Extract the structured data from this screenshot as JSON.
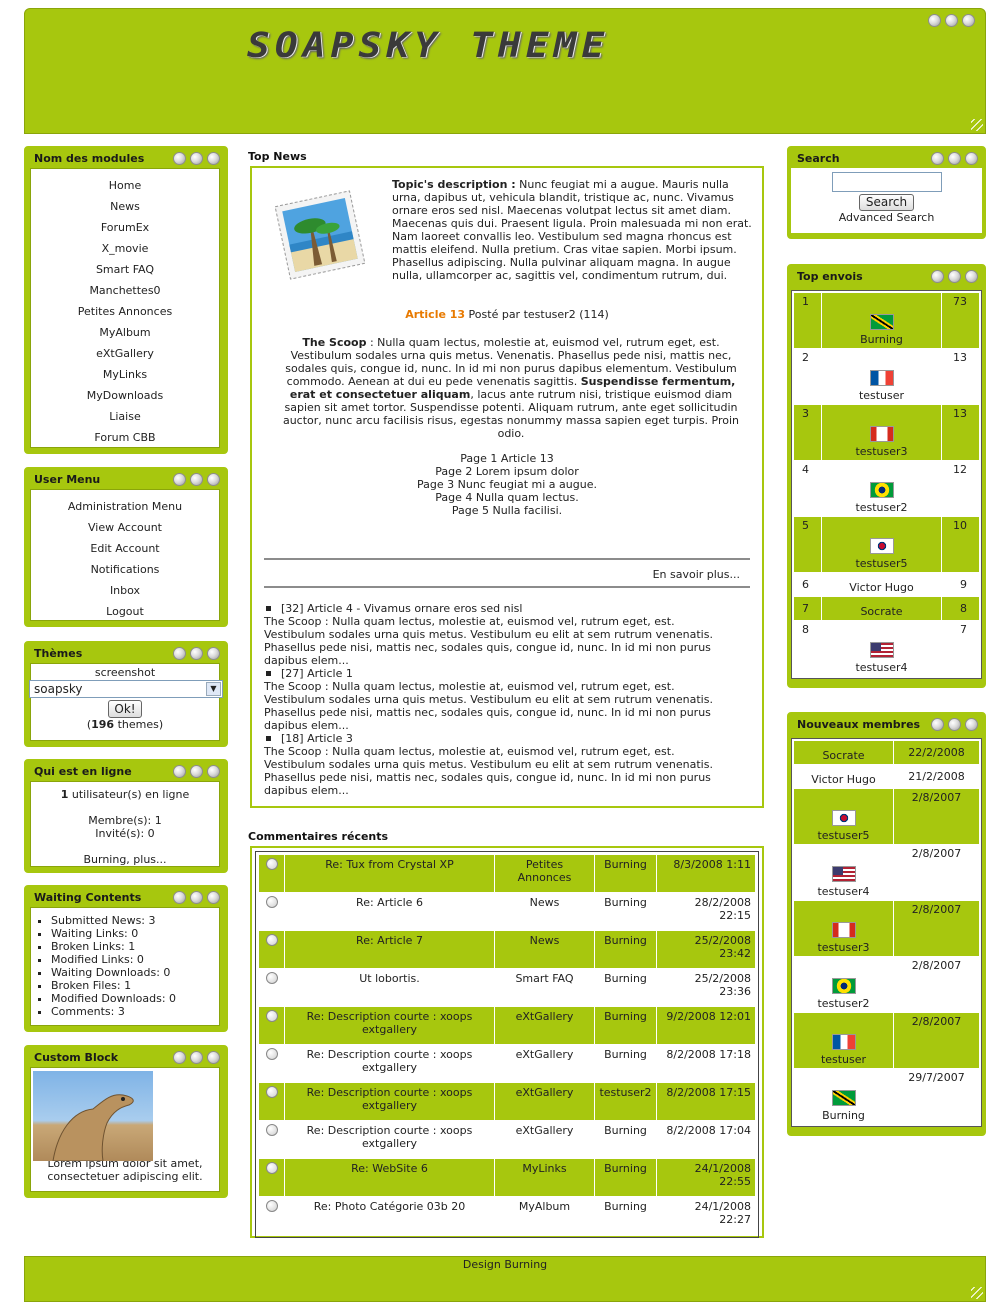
{
  "header": {
    "logo_text": "SOAPSKY THEME"
  },
  "modules": {
    "title": "Nom des modules",
    "items": [
      "Home",
      "News",
      "ForumEx",
      "X_movie",
      "Smart FAQ",
      "Manchettes0",
      "Petites Annonces",
      "MyAlbum",
      "eXtGallery",
      "MyLinks",
      "MyDownloads",
      "Liaise",
      "Forum CBB"
    ]
  },
  "user_menu": {
    "title": "User Menu",
    "items": [
      "Administration Menu",
      "View Account",
      "Edit Account",
      "Notifications",
      "Inbox",
      "Logout"
    ]
  },
  "themes": {
    "title": "Thèmes",
    "screenshot_label": "screenshot",
    "selected": "soapsky",
    "ok_label": "Ok!",
    "count_prefix": "(",
    "count": "196",
    "count_suffix": " themes)"
  },
  "online": {
    "title": "Qui est en ligne",
    "users_count": "1",
    "users_text": " utilisateur(s) en ligne",
    "members": "Membre(s): 1",
    "guests": "Invité(s): 0",
    "names": "Burning, plus..."
  },
  "waiting": {
    "title": "Waiting Contents",
    "items": [
      "Submitted News: 3",
      "Waiting Links: 0",
      "Broken Links: 1",
      "Modified Links: 0",
      "Waiting Downloads: 0",
      "Broken Files: 1",
      "Modified Downloads: 0",
      "Comments: 3"
    ]
  },
  "custom": {
    "title": "Custom Block",
    "text": "Lorem ipsum dolor sit amet, consectetuer adipiscing elit."
  },
  "top_news": {
    "title": "Top News",
    "desc_label": "Topic's description :",
    "desc_text": " Nunc feugiat mi a augue. Mauris nulla urna, dapibus ut, vehicula blandit, tristique ac, nunc. Vivamus ornare eros sed nisl. Maecenas volutpat lectus sit amet diam. Maecenas quis dui. Praesent ligula. Proin malesuada mi non erat. Nam laoreet convallis leo. Vestibulum sed magna rhoncus est mattis eleifend. Nulla pretium. Cras vitae sapien. Morbi ipsum. Phasellus adipiscing. Nulla pulvinar aliquam magna. In augue nulla, ullamcorper ac, sagittis vel, condimentum rutrum, dui.",
    "article_link": "Article 13",
    "posted_by": " Posté par testuser2 (114)",
    "scoop_label": "The Scoop",
    "scoop_text": " : Nulla quam lectus, molestie at, euismod vel, rutrum eget, est. Vestibulum sodales urna quis metus. Venenatis. Phasellus pede nisi, mattis nec, sodales quis, congue id, nunc. In id mi non purus dapibus elementum. Vestibulum commodo. Aenean at dui eu pede venenatis sagittis. ",
    "scoop_bold": "Suspendisse fermentum, erat et consectetuer aliquam",
    "scoop_tail": ", lacus ante rutrum nisi, tristique euismod diam sapien sit amet tortor. Suspendisse potenti. Aliquam rutrum, ante eget sollicitudin auctor, nunc arcu facilisis risus, egestas nonummy massa sapien eget turpis. Proin odio.",
    "pages": [
      "Page 1 Article 13",
      "Page 2 Lorem ipsum dolor",
      "Page 3 Nunc feugiat mi a augue.",
      "Page 4 Nulla quam lectus.",
      "Page 5 Nulla facilisi."
    ],
    "read_more": "En savoir plus...",
    "list": [
      {
        "head": "[32] Article 4 - Vivamus ornare eros sed nisl",
        "body": "The Scoop : Nulla quam lectus, molestie at, euismod vel, rutrum eget, est. Vestibulum sodales urna quis metus. Vestibulum eu elit at sem rutrum venenatis. Phasellus pede nisi, mattis nec, sodales quis, congue id, nunc. In id mi non purus dapibus elem..."
      },
      {
        "head": "[27] Article 1",
        "body": "The Scoop : Nulla quam lectus, molestie at, euismod vel, rutrum eget, est. Vestibulum sodales urna quis metus. Vestibulum eu elit at sem rutrum venenatis. Phasellus pede nisi, mattis nec, sodales quis, congue id, nunc. In id mi non purus dapibus elem..."
      },
      {
        "head": "[18] Article 3",
        "body": "The Scoop : Nulla quam lectus, molestie at, euismod vel, rutrum eget, est. Vestibulum sodales urna quis metus. Vestibulum eu elit at sem rutrum venenatis. Phasellus pede nisi, mattis nec, sodales quis, congue id, nunc. In id mi non purus dapibus elem..."
      }
    ]
  },
  "comments": {
    "title": "Commentaires récents",
    "rows": [
      {
        "title": "Re: Tux from Crystal XP",
        "module": "Petites Annonces",
        "user": "Burning",
        "date": "8/3/2008 1:11"
      },
      {
        "title": "Re: Article 6",
        "module": "News",
        "user": "Burning",
        "date": "28/2/2008 22:15"
      },
      {
        "title": "Re: Article 7",
        "module": "News",
        "user": "Burning",
        "date": "25/2/2008 23:42"
      },
      {
        "title": "Ut lobortis.",
        "module": "Smart FAQ",
        "user": "Burning",
        "date": "25/2/2008 23:36"
      },
      {
        "title": "Re: Description courte : xoops extgallery",
        "module": "eXtGallery",
        "user": "Burning",
        "date": "9/2/2008 12:01"
      },
      {
        "title": "Re: Description courte : xoops extgallery",
        "module": "eXtGallery",
        "user": "Burning",
        "date": "8/2/2008 17:18"
      },
      {
        "title": "Re: Description courte : xoops extgallery",
        "module": "eXtGallery",
        "user": "testuser2",
        "date": "8/2/2008 17:15"
      },
      {
        "title": "Re: Description courte : xoops extgallery",
        "module": "eXtGallery",
        "user": "Burning",
        "date": "8/2/2008 17:04"
      },
      {
        "title": "Re: WebSite 6",
        "module": "MyLinks",
        "user": "Burning",
        "date": "24/1/2008 22:55"
      },
      {
        "title": "Re: Photo Catégorie 03b 20",
        "module": "MyAlbum",
        "user": "Burning",
        "date": "24/1/2008 22:27"
      }
    ]
  },
  "search": {
    "title": "Search",
    "button": "Search",
    "advanced": "Advanced Search"
  },
  "top_send": {
    "title": "Top envois",
    "rows": [
      {
        "rank": "1",
        "name": "Burning",
        "count": "73",
        "flag": "jamaica"
      },
      {
        "rank": "2",
        "name": "testuser",
        "count": "13",
        "flag": "france"
      },
      {
        "rank": "3",
        "name": "testuser3",
        "count": "13",
        "flag": "canada"
      },
      {
        "rank": "4",
        "name": "testuser2",
        "count": "12",
        "flag": "brazil"
      },
      {
        "rank": "5",
        "name": "testuser5",
        "count": "10",
        "flag": "korea"
      },
      {
        "rank": "6",
        "name": "Victor Hugo",
        "count": "9",
        "flag": ""
      },
      {
        "rank": "7",
        "name": "Socrate",
        "count": "8",
        "flag": ""
      },
      {
        "rank": "8",
        "name": "testuser4",
        "count": "7",
        "flag": "usa"
      }
    ]
  },
  "new_members": {
    "title": "Nouveaux membres",
    "rows": [
      {
        "name": "Socrate",
        "date": "22/2/2008",
        "flag": ""
      },
      {
        "name": "Victor Hugo",
        "date": "21/2/2008",
        "flag": ""
      },
      {
        "name": "testuser5",
        "date": "2/8/2007",
        "flag": "korea"
      },
      {
        "name": "testuser4",
        "date": "2/8/2007",
        "flag": "usa"
      },
      {
        "name": "testuser3",
        "date": "2/8/2007",
        "flag": "canada"
      },
      {
        "name": "testuser2",
        "date": "2/8/2007",
        "flag": "brazil"
      },
      {
        "name": "testuser",
        "date": "2/8/2007",
        "flag": "france"
      },
      {
        "name": "Burning",
        "date": "29/7/2007",
        "flag": "jamaica"
      }
    ]
  },
  "footer": {
    "text": "Design Burning"
  },
  "colors": {
    "accent": "#a7c70e",
    "link_orange": "#e87a00"
  }
}
